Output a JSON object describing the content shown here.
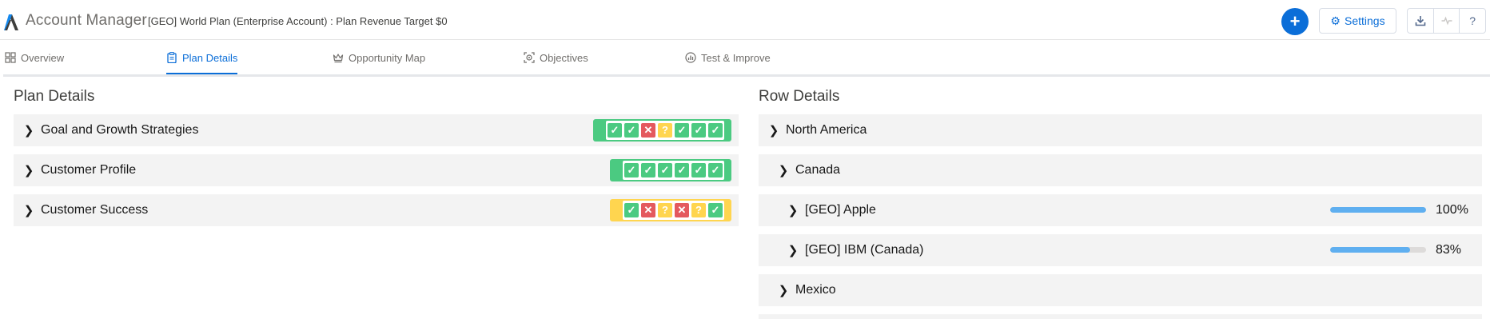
{
  "header": {
    "app_title": "Account Manager",
    "plan_title": "[GEO] World Plan (Enterprise Account) : Plan Revenue Target $0",
    "add_label": "+",
    "settings_label": "Settings",
    "settings_icon": "gear-icon",
    "tool_icons": [
      "download-icon",
      "activity-icon",
      "help-icon"
    ],
    "help_label": "?",
    "brand_color": "#0b6ed8"
  },
  "tabs": [
    {
      "label": "Overview",
      "icon": "grid-icon",
      "active": false
    },
    {
      "label": "Plan Details",
      "icon": "clipboard-icon",
      "active": true
    },
    {
      "label": "Opportunity Map",
      "icon": "crown-icon",
      "active": false
    },
    {
      "label": "Objectives",
      "icon": "target-icon",
      "active": false
    },
    {
      "label": "Test & Improve",
      "icon": "chart-icon",
      "active": false
    }
  ],
  "plan_details": {
    "title": "Plan Details",
    "rows": [
      {
        "label": "Goal and Growth Strategies",
        "status_color": "#4bca81",
        "checks": [
          "ok",
          "ok",
          "no",
          "q",
          "ok",
          "ok",
          "ok"
        ]
      },
      {
        "label": "Customer Profile",
        "status_color": "#4bca81",
        "checks": [
          "ok",
          "ok",
          "ok",
          "ok",
          "ok",
          "ok"
        ]
      },
      {
        "label": "Customer Success",
        "status_color": "#ffd54f",
        "checks": [
          "ok",
          "no",
          "q",
          "no",
          "q",
          "ok"
        ]
      }
    ]
  },
  "row_details": {
    "title": "Row Details",
    "rows": [
      {
        "label": "North America",
        "level": 0
      },
      {
        "label": "Canada",
        "level": 1
      },
      {
        "label": "[GEO] Apple",
        "level": 2,
        "progress": 1.0,
        "percent": "100%"
      },
      {
        "label": "[GEO] IBM (Canada)",
        "level": 2,
        "progress": 0.83,
        "percent": "83%"
      },
      {
        "label": "Mexico",
        "level": 1
      }
    ]
  }
}
